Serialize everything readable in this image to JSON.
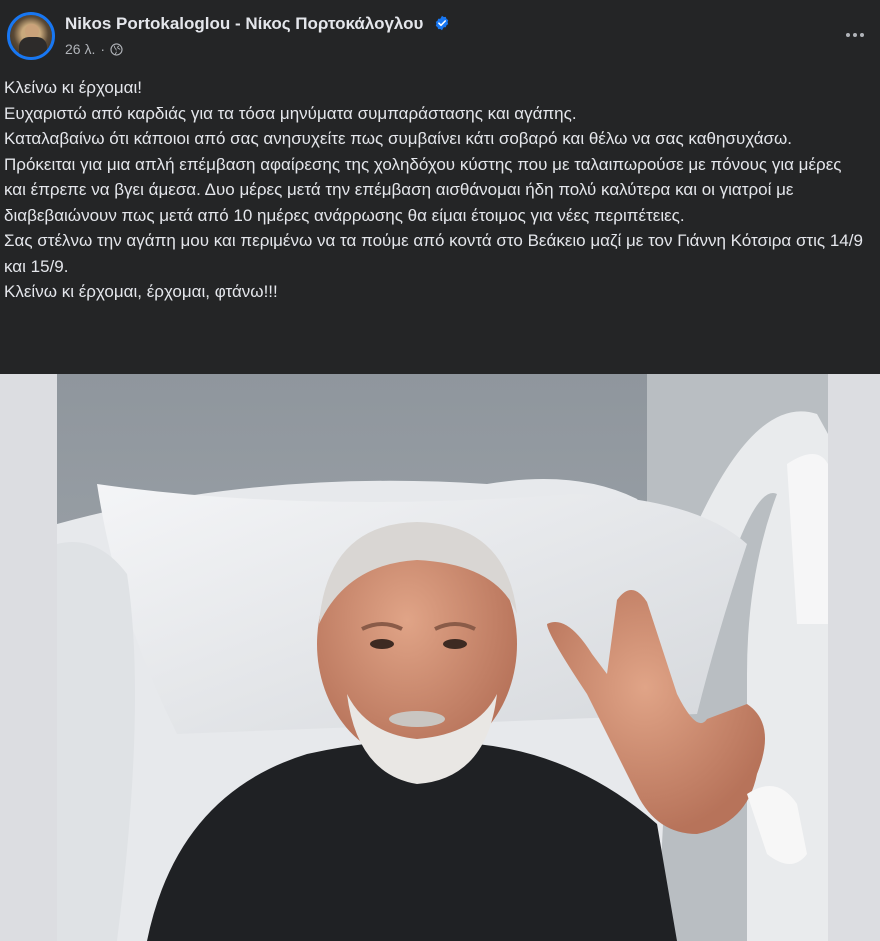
{
  "post": {
    "author": "Nikos Portokaloglou - Νίκος Πορτοκάλογλου",
    "timestamp": "26 λ.",
    "separator": "·",
    "audience_icon": "globe-icon",
    "verified_icon": "verified-badge-icon",
    "more_icon": "more-options-icon",
    "text_lines": [
      "Κλείνω κι έρχομαι!",
      "Ευχαριστώ από καρδιάς για τα τόσα μηνύματα συμπαράστασης και αγάπης.",
      "Καταλαβαίνω ότι κάποιοι από σας ανησυχείτε πως συμβαίνει κάτι σοβαρό και θέλω να σας καθησυχάσω.",
      "Πρόκειται για μια απλή επέμβαση αφαίρεσης της χοληδόχου κύστης που με ταλαιπωρούσε με πόνους για μέρες και έπρεπε να βγει άμεσα. Δυο μέρες μετά την επέμβαση αισθάνομαι ήδη πολύ καλύτερα και οι γιατροί με διαβεβαιώνουν πως μετά από 10 ημέρες ανάρρωσης θα είμαι έτοιμος για νέες περιπέτειες.",
      "Σας στέλνω την αγάπη μου και περιμένω να τα πούμε από κοντά στο Βεάκειο μαζί με τον Γιάννη Κότσιρα στις 14/9 και 15/9.",
      "Κλείνω κι έρχομαι, έρχομαι, φτάνω!!!"
    ]
  },
  "colors": {
    "background": "#242526",
    "text_primary": "#e4e6eb",
    "text_secondary": "#b0b3b8",
    "accent": "#1877f2"
  }
}
